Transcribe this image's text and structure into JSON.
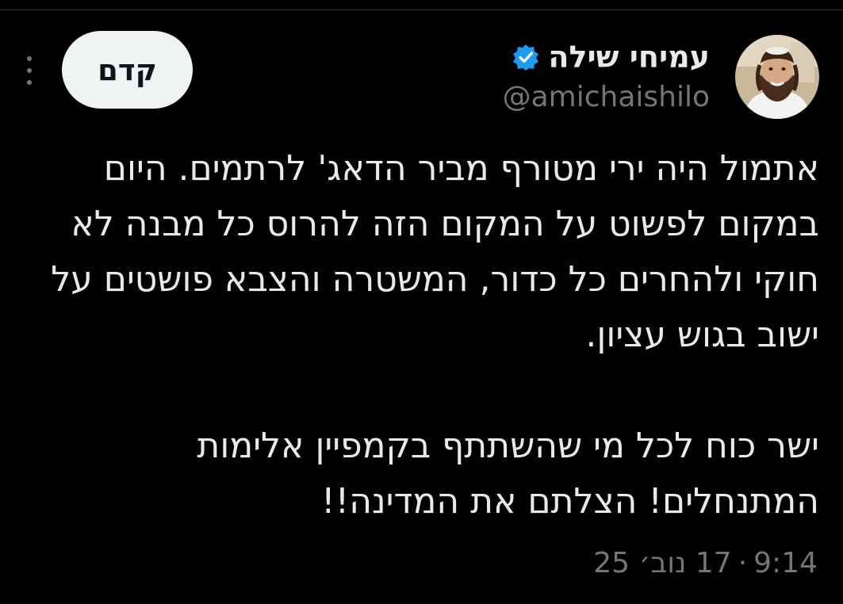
{
  "colors": {
    "background": "#000000",
    "text_primary": "#e7e9ea",
    "text_secondary": "#71767b",
    "follow_button_bg": "#eff3f4",
    "follow_button_text": "#0f1419",
    "verified_badge": "#1d9bf0",
    "divider": "#2f3336"
  },
  "author": {
    "display_name": "עמיחי שילה",
    "handle": "@amichaishilo",
    "verified_icon": "verified-badge-icon",
    "avatar_icon": "avatar"
  },
  "header": {
    "follow_label": "קדם",
    "more_icon": "more-vertical-icon"
  },
  "tweet": {
    "paragraph_1": "אתמול היה ירי מטורף מביר הדאג' לרתמים. היום במקום לפשוט על המקום הזה להרוס כל מבנה לא חוקי ולהחרים כל כדור, המשטרה והצבא פושטים על ישוב בגוש עציון.",
    "paragraph_2": "ישר כוח לכל מי שהשתתף בקמפיין אלימות המתנחלים! הצלתם את המדינה!!"
  },
  "meta": {
    "time": "9:14",
    "separator": "·",
    "date": "17 נוב׳ 25"
  }
}
